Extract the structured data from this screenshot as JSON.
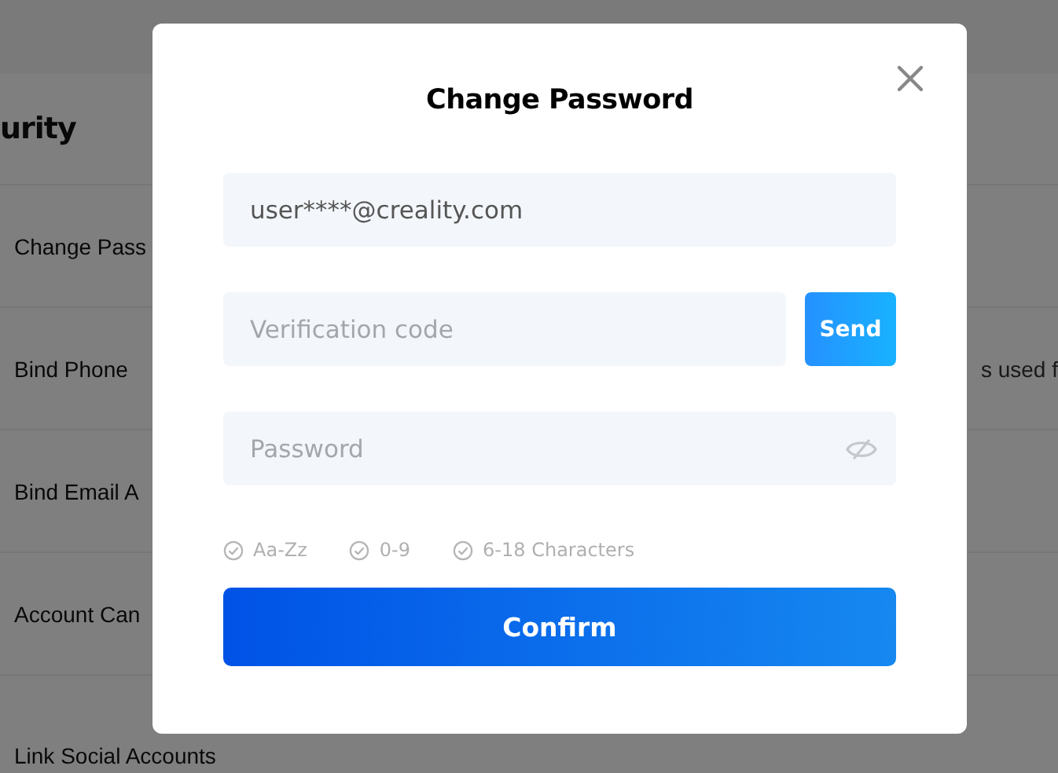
{
  "background": {
    "heading": "urity",
    "rows": [
      {
        "label": "Change Pass"
      },
      {
        "label": "Bind Phone",
        "note": "s used f"
      },
      {
        "label": "Bind Email A"
      },
      {
        "label": "Account Can"
      },
      {
        "label": "Link Social Accounts"
      }
    ]
  },
  "dialog": {
    "title": "Change Password",
    "email": {
      "value": "user****@creality.com"
    },
    "code": {
      "placeholder": "Verification code"
    },
    "send": "Send",
    "password": {
      "placeholder": "Password"
    },
    "rules": [
      {
        "label": "Aa-Zz",
        "met": false
      },
      {
        "label": "0-9",
        "met": false
      },
      {
        "label": "6-18 Characters",
        "met": false
      }
    ],
    "confirm": "Confirm"
  }
}
